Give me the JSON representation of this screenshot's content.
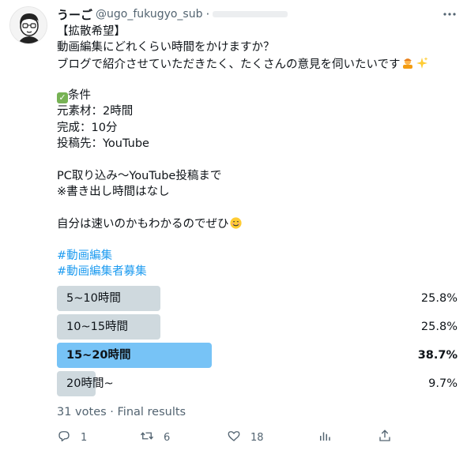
{
  "tweet": {
    "display_name": "うーご",
    "handle": "@ugo_fukugyo_sub",
    "separator": "·",
    "lines": [
      "【拡散希望】",
      "動画編集にどれくらい時間をかけますか？",
      "ブログで紹介させていただきたく、たくさんの意見を伺いたいです",
      "",
      "条件",
      "元素材：2時間",
      "完成：10分",
      "投稿先：YouTube",
      "",
      "PC取り込み〜YouTube投稿まで",
      "※書き出し時間はなし",
      "",
      "自分は速いのかもわかるのでぜひ"
    ],
    "hashtags": [
      "#動画編集",
      "#動画編集者募集"
    ]
  },
  "poll": {
    "options": [
      {
        "label": "5~10時間",
        "percent_label": "25.8%",
        "percent": 25.8,
        "winner": false
      },
      {
        "label": "10~15時間",
        "percent_label": "25.8%",
        "percent": 25.8,
        "winner": false
      },
      {
        "label": "15~20時間",
        "percent_label": "38.7%",
        "percent": 38.7,
        "winner": true
      },
      {
        "label": "20時間~",
        "percent_label": "9.7%",
        "percent": 9.7,
        "winner": false
      }
    ],
    "results_text": "31 votes · Final results"
  },
  "actions": {
    "reply_count": "1",
    "retweet_count": "6",
    "like_count": "18"
  },
  "icons": {
    "reply": "reply-icon",
    "retweet": "retweet-icon",
    "like": "heart-icon",
    "analytics": "analytics-icon",
    "share": "share-icon",
    "more": "more-icon"
  },
  "colors": {
    "accent": "#1d9bf0",
    "secondary_text": "#536471",
    "poll_bar": "#cfd9de"
  }
}
